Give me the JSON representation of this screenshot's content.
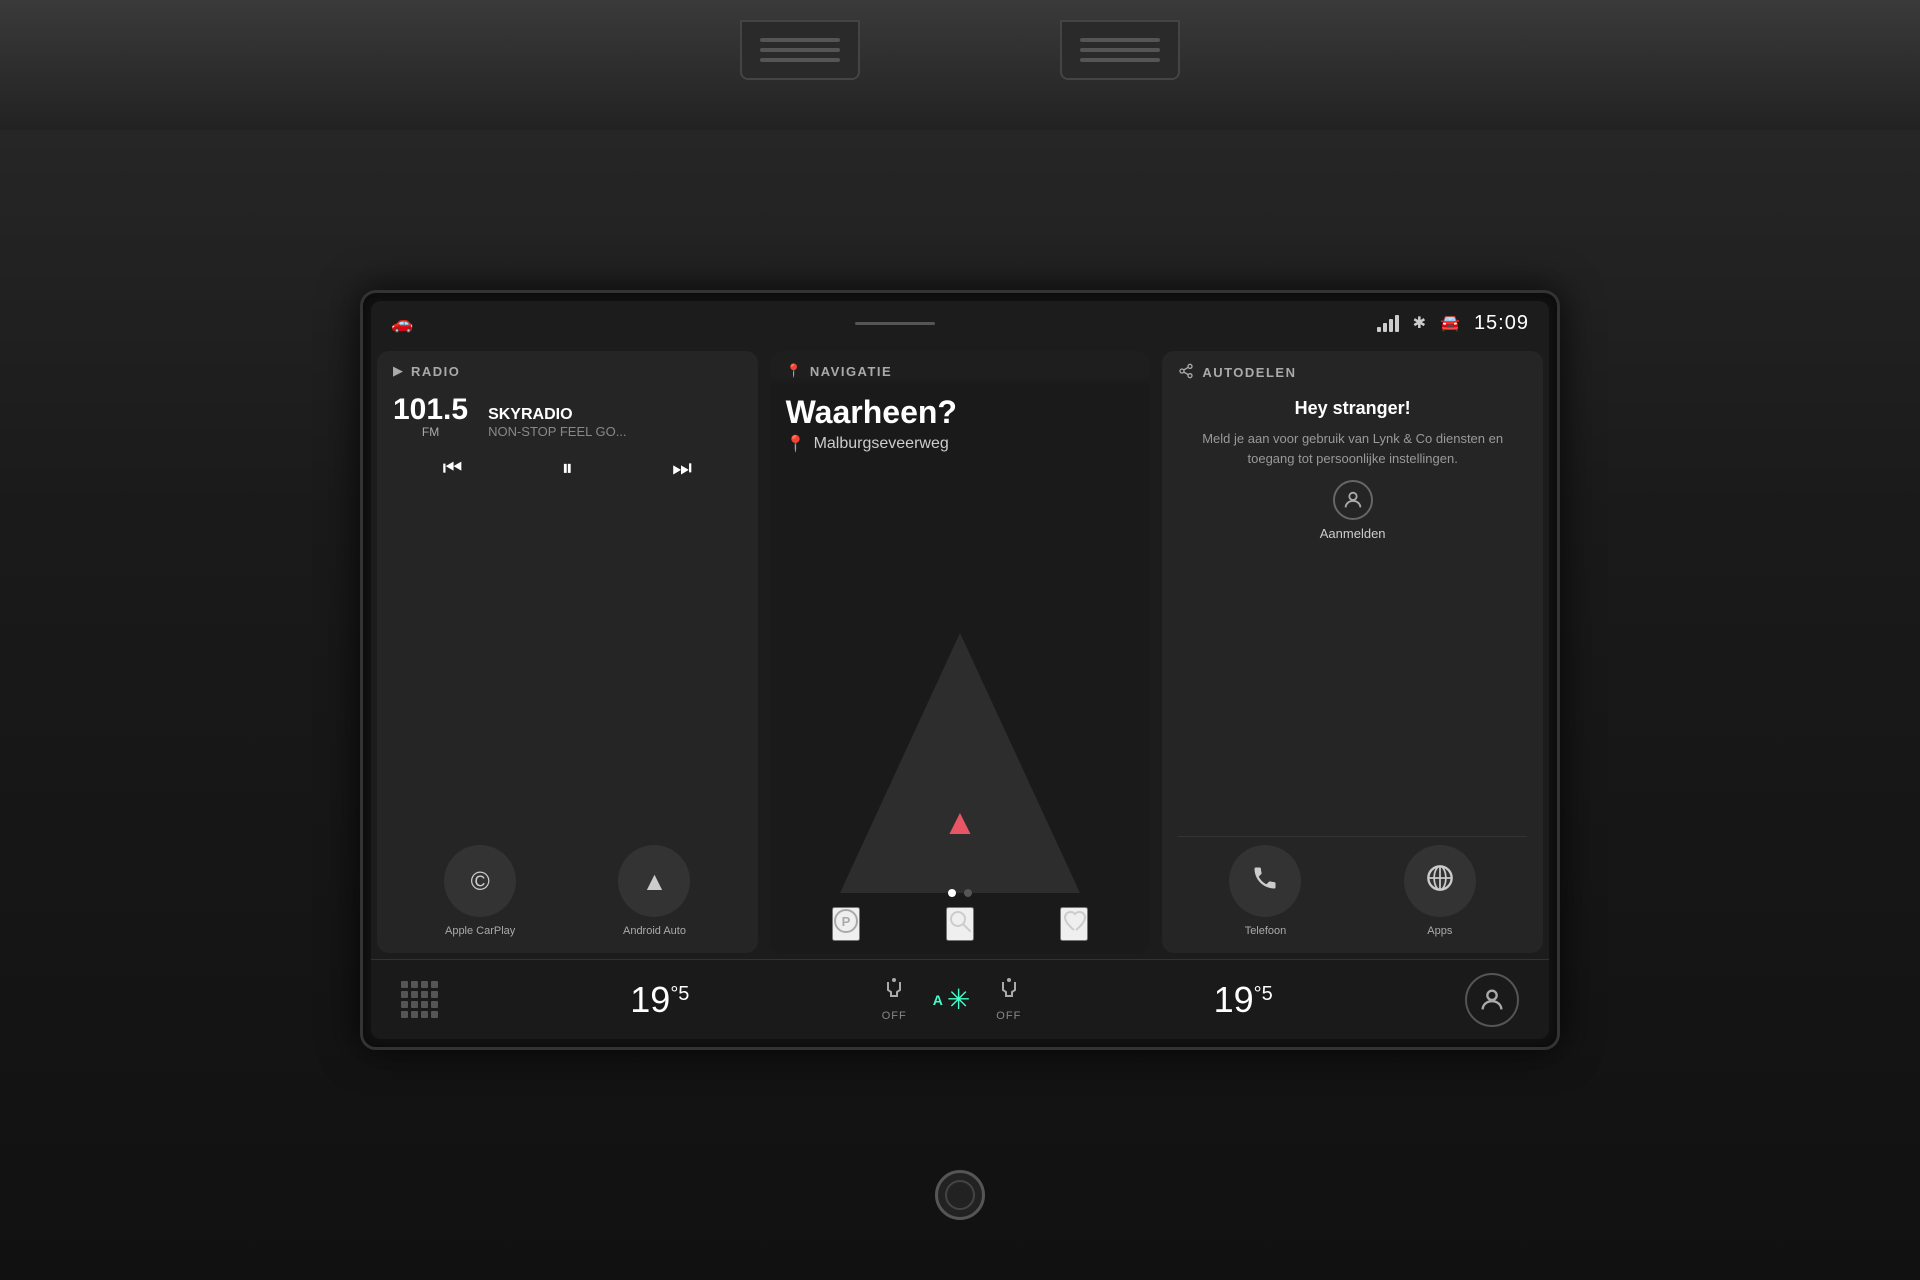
{
  "statusBar": {
    "time": "15:09",
    "carIcon": "🚗",
    "btIcon": "Ɓ"
  },
  "radio": {
    "headerIcon": "▶",
    "headerTitle": "RADIO",
    "frequency": "101.5",
    "freqUnit": "FM",
    "stationName": "SKYRADIO",
    "stationDesc": "NON-STOP FEEL GO...",
    "prevIcon": "⏮",
    "pauseIcon": "⏸",
    "nextIcon": "⏭",
    "carplayLabel": "Apple CarPlay",
    "androidLabel": "Android Auto"
  },
  "navigation": {
    "headerIcon": "📍",
    "headerTitle": "NAVIGATIE",
    "title": "Waarheen?",
    "locationPin": "📍",
    "location": "Malburgseveerweg",
    "parkIcon": "P",
    "searchIcon": "🔍",
    "heartIcon": "♡"
  },
  "autodelen": {
    "headerIcon": "↗",
    "headerTitle": "AUTODELEN",
    "greeting": "Hey stranger!",
    "description": "Meld je aan voor gebruik van Lynk & Co diensten en toegang tot persoonlijke instellingen.",
    "loginLabel": "Aanmelden",
    "phoneLabel": "Telefoon",
    "appsLabel": "Apps"
  },
  "climate": {
    "leftTemp": "19",
    "leftTempDeg": "°5",
    "rightTemp": "19",
    "rightTempDeg": "°5",
    "fanMode": "A",
    "offLabel": "OFF",
    "offLabel2": "OFF"
  }
}
